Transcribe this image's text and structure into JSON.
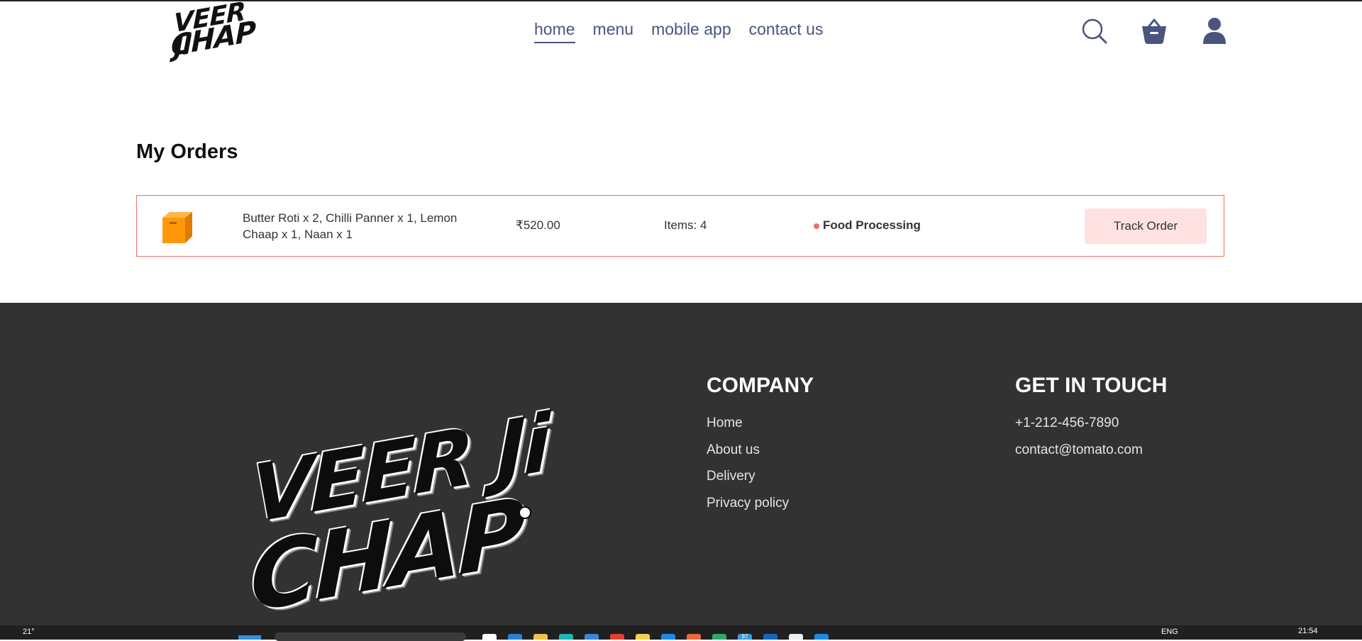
{
  "brand": {
    "logo_line1": "VEER JI",
    "logo_line2": "CHAP",
    "logo_mark": "®"
  },
  "nav": {
    "items": [
      {
        "label": "home",
        "active": true
      },
      {
        "label": "menu",
        "active": false
      },
      {
        "label": "mobile app",
        "active": false
      },
      {
        "label": "contact us",
        "active": false
      }
    ]
  },
  "header_icons": {
    "search": "search-icon",
    "basket": "basket-icon",
    "profile": "profile-icon"
  },
  "colors": {
    "nav_text": "#49557e",
    "accent": "#f06f64",
    "track_button_bg": "#ffe1e1",
    "footer_bg": "#323232"
  },
  "orders": {
    "title": "My Orders",
    "list": [
      {
        "icon": "parcel-icon",
        "items": "Butter Roti x 2, Chilli Panner x 1, Lemon Chaap x 1, Naan x 1",
        "amount": "₹520.00",
        "count": "Items: 4",
        "status": "Food Processing",
        "action": "Track Order"
      }
    ]
  },
  "footer": {
    "logo_line1": "VEER Ji",
    "logo_line2": "CHAP",
    "company": {
      "heading": "COMPANY",
      "links": [
        "Home",
        "About us",
        "Delivery",
        "Privacy policy"
      ]
    },
    "contact": {
      "heading": "GET IN TOUCH",
      "phone": "+1-212-456-7890",
      "email": "contact@tomato.com"
    }
  },
  "taskbar": {
    "weather": "21°",
    "language": "ENG",
    "time": "21:54",
    "badge": "97"
  }
}
